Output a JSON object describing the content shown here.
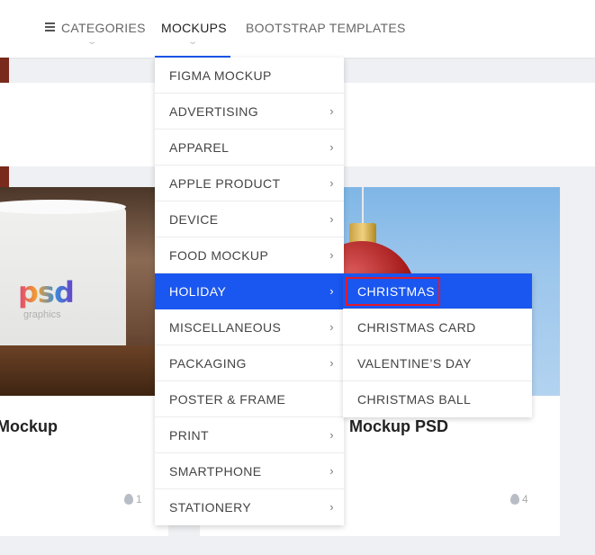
{
  "nav": {
    "categories_label": "CATEGORIES",
    "mockups_label": "MOCKUPS",
    "bootstrap_label": "BOOTSTRAP TEMPLATES"
  },
  "menu": {
    "items": [
      {
        "label": "FIGMA MOCKUP",
        "has_submenu": false
      },
      {
        "label": "ADVERTISING",
        "has_submenu": true
      },
      {
        "label": "APPAREL",
        "has_submenu": true
      },
      {
        "label": "APPLE PRODUCT",
        "has_submenu": true
      },
      {
        "label": "DEVICE",
        "has_submenu": true
      },
      {
        "label": "FOOD MOCKUP",
        "has_submenu": true
      },
      {
        "label": "HOLIDAY",
        "has_submenu": true,
        "active": true
      },
      {
        "label": "MISCELLANEOUS",
        "has_submenu": true
      },
      {
        "label": "PACKAGING",
        "has_submenu": true
      },
      {
        "label": "POSTER & FRAME",
        "has_submenu": false
      },
      {
        "label": "PRINT",
        "has_submenu": true
      },
      {
        "label": "SMARTPHONE",
        "has_submenu": true
      },
      {
        "label": "STATIONERY",
        "has_submenu": true
      }
    ],
    "arrow_glyph": "›"
  },
  "submenu": {
    "items": [
      "CHRISTMAS",
      "CHRISTMAS CARD",
      "VALENTINE’S DAY",
      "CHRISTMAS BALL"
    ],
    "active_index": 0
  },
  "cards": {
    "left": {
      "title": "Mockup",
      "count": "1",
      "image_logo": "psd",
      "image_sub": "graphics"
    },
    "mid": {
      "title": "l Mockup PSD",
      "count": "4"
    }
  },
  "colors": {
    "accent": "#1a56f0",
    "highlight_border": "#e01b2c"
  }
}
